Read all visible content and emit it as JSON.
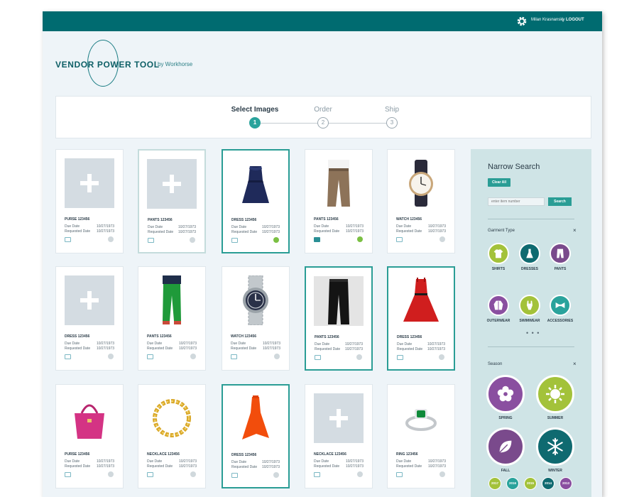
{
  "header": {
    "user_name": "Milan Krasnansky",
    "separator": "|",
    "logout_label": "LOGOUT"
  },
  "brand": {
    "title": "VENDOR POWER TOOL",
    "by": "by Workhorse"
  },
  "steps": [
    {
      "label": "Select Images",
      "number": "1",
      "active": true
    },
    {
      "label": "Order",
      "number": "2",
      "active": false
    },
    {
      "label": "Ship",
      "number": "3",
      "active": false
    }
  ],
  "card_labels": {
    "due": "Due Date",
    "requested": "Requested Date"
  },
  "cards": [
    {
      "title": "PURSE 123456",
      "due": "10/27/1973",
      "requested": "10/27/1973",
      "image": "placeholder",
      "state": "default",
      "message": "outline",
      "status": "gray"
    },
    {
      "title": "PANTS 123456",
      "due": "10/27/1973",
      "requested": "10/27/1973",
      "image": "placeholder",
      "state": "light",
      "message": "outline",
      "status": "gray"
    },
    {
      "title": "DRESS 123456",
      "due": "10/27/1973",
      "requested": "10/27/1973",
      "image": "dress-navy",
      "state": "selected",
      "message": "outline",
      "status": "green"
    },
    {
      "title": "PANTS 123456",
      "due": "10/27/1973",
      "requested": "10/27/1973",
      "image": "pants-khaki",
      "state": "default",
      "message": "filled",
      "status": "green"
    },
    {
      "title": "WATCH 123456",
      "due": "10/27/1973",
      "requested": "10/27/1973",
      "image": "watch-leather",
      "state": "default",
      "message": "outline",
      "status": "gray"
    },
    {
      "title": "DRESS 123456",
      "due": "10/27/1973",
      "requested": "10/27/1973",
      "image": "placeholder",
      "state": "default",
      "message": "outline",
      "status": "gray"
    },
    {
      "title": "PANTS 123456",
      "due": "10/27/1973",
      "requested": "10/27/1973",
      "image": "pants-green",
      "state": "default",
      "message": "outline",
      "status": "gray"
    },
    {
      "title": "WATCH 123456",
      "due": "10/27/1973",
      "requested": "10/27/1973",
      "image": "watch-steel",
      "state": "default",
      "message": "outline",
      "status": "gray"
    },
    {
      "title": "PANTS 123456",
      "due": "10/27/1973",
      "requested": "10/27/1973",
      "image": "pants-black",
      "state": "selected",
      "message": "outline",
      "status": "gray"
    },
    {
      "title": "DRESS 123456",
      "due": "10/27/1973",
      "requested": "10/27/1973",
      "image": "dress-red",
      "state": "selected",
      "message": "outline",
      "status": "gray"
    },
    {
      "title": "PURSE 123456",
      "due": "10/27/1973",
      "requested": "10/27/1973",
      "image": "purse-pink",
      "state": "default",
      "message": "outline",
      "status": "gray"
    },
    {
      "title": "NECKLACE 123456",
      "due": "10/27/1973",
      "requested": "10/27/1973",
      "image": "necklace-gold",
      "state": "default",
      "message": "outline",
      "status": "gray"
    },
    {
      "title": "DRESS 123456",
      "due": "10/27/1973",
      "requested": "10/27/1973",
      "image": "dress-orange",
      "state": "selected",
      "message": "outline",
      "status": "gray"
    },
    {
      "title": "NECKLACE 123456",
      "due": "10/27/1973",
      "requested": "10/27/1973",
      "image": "placeholder",
      "state": "default",
      "message": "outline",
      "status": "gray"
    },
    {
      "title": "RING 123456",
      "due": "10/27/1973",
      "requested": "10/27/1973",
      "image": "ring-emerald",
      "state": "default",
      "message": "outline",
      "status": "gray"
    }
  ],
  "sidebar": {
    "title": "Narrow Search",
    "clear_all": "Clear All",
    "search_placeholder": "enter item number",
    "search_button": "Search",
    "garment_section": "Garment Type",
    "close_glyph": "×",
    "more_glyph": "• • •",
    "garment_types": [
      {
        "label": "SHIRTS",
        "color": "#a3c23a",
        "icon": "shirt-icon"
      },
      {
        "label": "DRESSES",
        "color": "#0f6a70",
        "icon": "dress-icon"
      },
      {
        "label": "PANTS",
        "color": "#7a4a8c",
        "icon": "pants-icon"
      },
      {
        "label": "OUTERWEAR",
        "color": "#8a4fa0",
        "icon": "jacket-icon"
      },
      {
        "label": "SWIMWEAR",
        "color": "#a3c23a",
        "icon": "swimsuit-icon"
      },
      {
        "label": "ACCESSORIES",
        "color": "#2aa39c",
        "icon": "bowtie-icon"
      }
    ],
    "season_section": "Season",
    "seasons": [
      {
        "label": "SPRING",
        "color": "#8a4fa0",
        "icon": "flower-icon"
      },
      {
        "label": "SUMMER",
        "color": "#a3c23a",
        "icon": "sun-icon"
      },
      {
        "label": "FALL",
        "color": "#7a4a8c",
        "icon": "leaf-icon"
      },
      {
        "label": "WINTER",
        "color": "#0f6a70",
        "icon": "snowflake-icon"
      }
    ],
    "years": [
      {
        "label": "2017",
        "color": "#a3c23a"
      },
      {
        "label": "2016",
        "color": "#2aa39c"
      },
      {
        "label": "2015",
        "color": "#a3c23a"
      },
      {
        "label": "2014",
        "color": "#0f6a70"
      },
      {
        "label": "2013",
        "color": "#8a4fa0"
      }
    ]
  }
}
